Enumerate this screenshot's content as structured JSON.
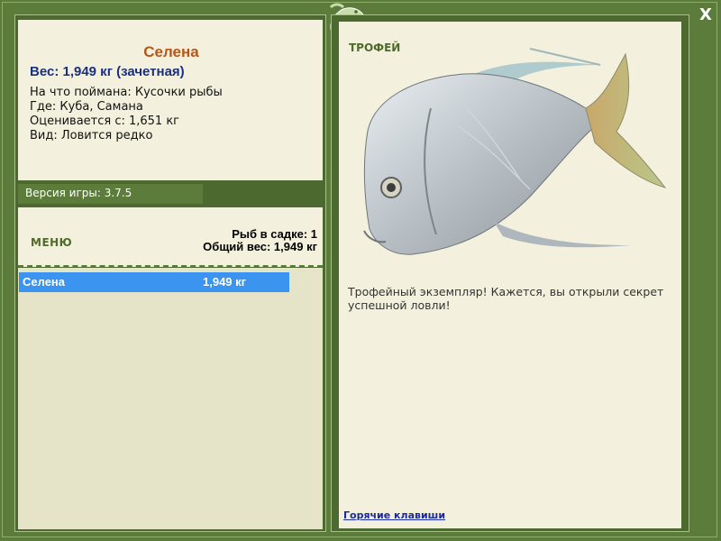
{
  "window": {
    "close_label": "X",
    "logo_icon": "gecko-logo-icon"
  },
  "catch": {
    "name": "Селена",
    "weight": "Вес: 1,949 кг (зачетная)",
    "bait": "На что поймана: Кусочки рыбы",
    "place": "Где: Куба, Самана",
    "valued_from": "Оценивается с: 1,651 кг",
    "rarity": "Вид: Ловится редко"
  },
  "version": "Версия игры: 3.7.5",
  "menu": {
    "label": "МЕНЮ"
  },
  "keepnet": {
    "count": "Рыб в садке: 1",
    "total": "Общий вес: 1,949 кг",
    "items": [
      {
        "name": "Селена",
        "weight": "1,949 кг"
      }
    ]
  },
  "trophy": {
    "label": "ТРОФЕЙ",
    "fish_icon": "lookdown-fish-icon",
    "message": "Трофейный экземпляр! Кажется, вы открыли секрет успешной ловли!"
  },
  "hotkeys_label": "Горячие клавиши",
  "colors": {
    "frame": "#5b7c3b",
    "panel_bg": "#f3f1dd",
    "list_bg": "#e6e4c8",
    "selection": "#3b95f0",
    "name": "#b5561b",
    "weight": "#1a2f80"
  }
}
